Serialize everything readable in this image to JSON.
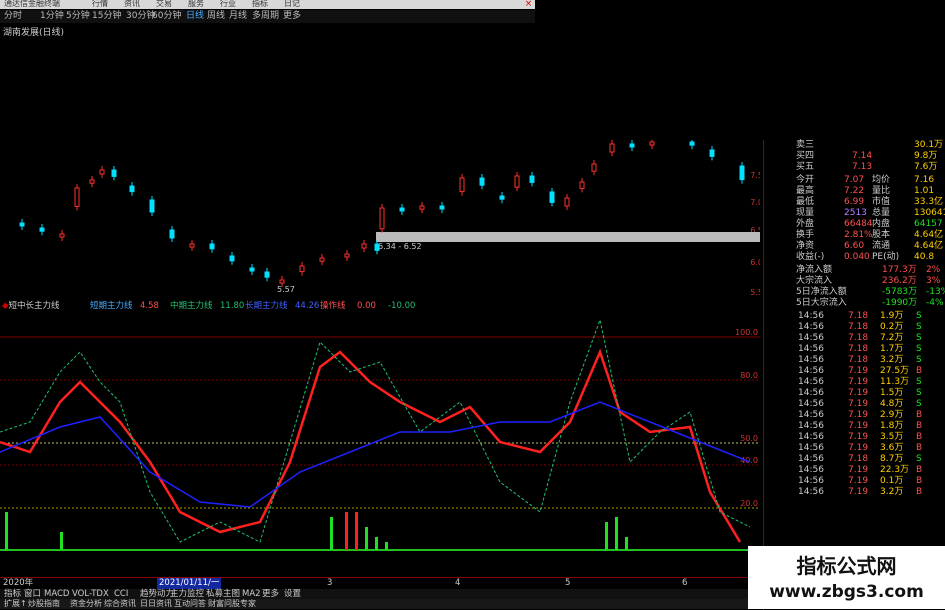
{
  "menubar": {
    "items": [
      "通达信金融终端",
      "行情",
      "资讯",
      "交易",
      "服务",
      "行业",
      "指标",
      "日记"
    ],
    "close": "×"
  },
  "periods": [
    "分时",
    "1分钟",
    "5分钟",
    "15分钟",
    "30分钟",
    "60分钟",
    "日线",
    "周线",
    "月线",
    "多周期",
    "更多"
  ],
  "active_period": "日线",
  "stock_title": "湖南发展(日线)",
  "price_chart": {
    "y_ticks": [
      "7.50",
      "7.00",
      "6.50",
      "6.00",
      "5.50"
    ],
    "range_label": "6.34 - 6.52",
    "low_label": "5.57"
  },
  "quote_panel": {
    "asks": [
      {
        "label": "卖三",
        "price": "",
        "vol": "30.1万"
      },
      {
        "label": "买四",
        "price": "7.14",
        "vol": "9.8万"
      },
      {
        "label": "买五",
        "price": "7.13",
        "vol": "7.6万"
      }
    ],
    "stats": [
      {
        "l1": "今开",
        "v1": "7.07",
        "l2": "均价",
        "v2": "7.16"
      },
      {
        "l1": "最高",
        "v1": "7.22",
        "l2": "量比",
        "v2": "1.01"
      },
      {
        "l1": "最低",
        "v1": "6.99",
        "l2": "市值",
        "v2": "33.3亿"
      },
      {
        "l1": "现量",
        "v1": "2513",
        "l2": "总量",
        "v2": "130641"
      },
      {
        "l1": "外盘",
        "v1": "66484",
        "l2": "内盘",
        "v2": "64157"
      },
      {
        "l1": "换手",
        "v1": "2.81%",
        "l2": "股本",
        "v2": "4.64亿"
      },
      {
        "l1": "净资",
        "v1": "6.60",
        "l2": "流通",
        "v2": "4.64亿"
      },
      {
        "l1": "收益(-)",
        "v1": "0.040",
        "l2": "PE(动)",
        "v2": "40.8"
      }
    ],
    "flows": [
      {
        "label": "净流入额",
        "value": "177.3万",
        "pct": "2%"
      },
      {
        "label": "大宗流入",
        "value": "236.2万",
        "pct": "3%"
      },
      {
        "label": "5日净流入额",
        "value": "-5783万",
        "pct": "-13%"
      },
      {
        "label": "5日大宗流入",
        "value": "-1990万",
        "pct": "-4%"
      }
    ],
    "ticks": [
      {
        "t": "14:56",
        "p": "7.18",
        "v": "1.9万",
        "d": "S"
      },
      {
        "t": "14:56",
        "p": "7.18",
        "v": "0.2万",
        "d": "S"
      },
      {
        "t": "14:56",
        "p": "7.18",
        "v": "7.2万",
        "d": "S"
      },
      {
        "t": "14:56",
        "p": "7.18",
        "v": "1.7万",
        "d": "S"
      },
      {
        "t": "14:56",
        "p": "7.18",
        "v": "3.2万",
        "d": "S"
      },
      {
        "t": "14:56",
        "p": "7.19",
        "v": "27.5万",
        "d": "B"
      },
      {
        "t": "14:56",
        "p": "7.19",
        "v": "11.3万",
        "d": "S"
      },
      {
        "t": "14:56",
        "p": "7.19",
        "v": "1.5万",
        "d": "S"
      },
      {
        "t": "14:56",
        "p": "7.19",
        "v": "4.8万",
        "d": "S"
      },
      {
        "t": "14:56",
        "p": "7.19",
        "v": "2.9万",
        "d": "B"
      },
      {
        "t": "14:56",
        "p": "7.19",
        "v": "1.8万",
        "d": "B"
      },
      {
        "t": "14:56",
        "p": "7.19",
        "v": "3.5万",
        "d": "B"
      },
      {
        "t": "14:56",
        "p": "7.19",
        "v": "3.6万",
        "d": "B"
      },
      {
        "t": "14:56",
        "p": "7.18",
        "v": "8.7万",
        "d": "S"
      },
      {
        "t": "14:56",
        "p": "7.19",
        "v": "22.3万",
        "d": "B"
      },
      {
        "t": "14:56",
        "p": "7.19",
        "v": "0.1万",
        "d": "B"
      },
      {
        "t": "14:56",
        "p": "7.19",
        "v": "3.2万",
        "d": "B"
      }
    ]
  },
  "indicator": {
    "name": "短中长主力线",
    "short_label": "短期主力线",
    "short_val": "4.58",
    "mid_label": "中期主力线",
    "mid_val": "11.80",
    "long_label": "长期主力线",
    "long_val": "44.26",
    "rise_label": "操作线",
    "rise_val": "0.00",
    "extra_val": "-10.00",
    "levels": [
      "100.0",
      "80.0",
      "50.0",
      "40.0",
      "20.0"
    ]
  },
  "date_axis": {
    "start": "2020年",
    "cursor": "2021/01/11/一",
    "months": [
      "3",
      "4",
      "5",
      "6"
    ]
  },
  "tabs_row1": [
    "指标",
    "窗口",
    "MACD",
    "VOL-TDX",
    "CCI",
    "趋势动力",
    "主力监控",
    "私募主图",
    "MA2",
    "更多",
    "设置"
  ],
  "tabs_row2": [
    "扩展↑",
    "炒股指南",
    "资金分析",
    "综合资讯",
    "日日资讯",
    "互动问答",
    "财富问股专家"
  ],
  "watermark": {
    "line1": "指标公式网",
    "line2": "www.zbgs3.com"
  },
  "colors": {
    "up": "#ff3030",
    "down": "#00ffff",
    "short_line": "#ff2020",
    "mid_line": "#20c070",
    "long_line": "#2020ff",
    "grid": "#800000"
  }
}
